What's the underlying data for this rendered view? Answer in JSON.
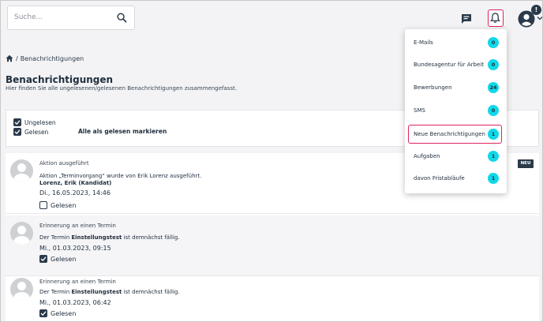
{
  "search": {
    "placeholder": "Suche..."
  },
  "header": {
    "user_badge": "!"
  },
  "breadcrumb": {
    "current": "Benachrichtigungen"
  },
  "page": {
    "title": "Benachrichtigungen",
    "subtitle": "Hier finden Sie alle ungelesenen/gelesenen Benachrichtigungen zusammengefasst."
  },
  "filter": {
    "unread_label": "Ungelesen",
    "read_label": "Gelesen",
    "mark_all_label": "Alle als gelesen markieren"
  },
  "notifications": [
    {
      "title": "Aktion ausgeführt",
      "line1": "Aktion „Terminvorgang“ wurde von Erik Lorenz ausgeführt.",
      "line2": "Lorenz, Erik (Kandidat)",
      "date": "Di., 16.05.2023, 14:46",
      "read_label": "Gelesen",
      "read": false,
      "badge": "NEU"
    },
    {
      "title": "Erinnerung an einen Termin",
      "text_before": "Der Termin ",
      "text_bold": "Einstellungstest",
      "text_after": " ist demnächst fällig.",
      "date": "Mi., 01.03.2023, 09:15",
      "read_label": "Gelesen",
      "read": true
    },
    {
      "title": "Erinnerung an einen Termin",
      "text_before": "Der Termin ",
      "text_bold": "Einstellungstest",
      "text_after": " ist demnächst fällig.",
      "date": "Mi., 01.03.2023, 06:42",
      "read_label": "Gelesen",
      "read": true
    }
  ],
  "dropdown": {
    "items": [
      {
        "label": "E-Mails",
        "count": "0"
      },
      {
        "label": "Bundesagentur für Arbeit",
        "count": "0"
      },
      {
        "label": "Bewerbungen",
        "count": "24"
      },
      {
        "label": "SMS",
        "count": "0"
      },
      {
        "label": "Neue Benachrichtigungen",
        "count": "1"
      },
      {
        "label": "Aufgaben",
        "count": "1"
      },
      {
        "label": "davon Fristabläufe",
        "count": "1"
      }
    ]
  },
  "colors": {
    "accent": "#10d8e8",
    "highlight": "#e0245e",
    "dark": "#2b3a4a"
  }
}
